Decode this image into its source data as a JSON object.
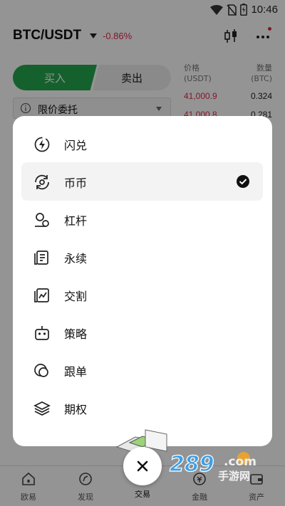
{
  "status_bar": {
    "time": "10:46"
  },
  "header": {
    "pair": "BTC/USDT",
    "change": "-0.86%"
  },
  "trade_tabs": {
    "buy": "买入",
    "sell": "卖出"
  },
  "order_type": {
    "label": "限价委托"
  },
  "order_book": {
    "price_header": "价格",
    "price_unit": "(USDT)",
    "qty_header": "数量",
    "qty_unit": "(BTC)",
    "rows": [
      {
        "price": "41,000.9",
        "qty": "0.324"
      },
      {
        "price": "41,000.8",
        "qty": "0.281"
      }
    ]
  },
  "menu": {
    "items": [
      {
        "label": "闪兑",
        "icon": "flash-swap-icon",
        "selected": false
      },
      {
        "label": "币币",
        "icon": "spot-icon",
        "selected": true
      },
      {
        "label": "杠杆",
        "icon": "margin-icon",
        "selected": false
      },
      {
        "label": "永续",
        "icon": "perpetual-icon",
        "selected": false
      },
      {
        "label": "交割",
        "icon": "futures-icon",
        "selected": false
      },
      {
        "label": "策略",
        "icon": "bot-icon",
        "selected": false
      },
      {
        "label": "跟单",
        "icon": "copy-trade-icon",
        "selected": false
      },
      {
        "label": "期权",
        "icon": "options-icon",
        "selected": false
      }
    ]
  },
  "bottom_nav": [
    {
      "label": "欧易",
      "icon": "home-icon"
    },
    {
      "label": "发现",
      "icon": "discover-icon"
    },
    {
      "label": "交易",
      "icon": "trade-icon"
    },
    {
      "label": "金融",
      "icon": "finance-icon"
    },
    {
      "label": "资产",
      "icon": "assets-icon"
    }
  ],
  "watermark": {
    "number": "289",
    "domain": ".com",
    "site": "手游网"
  },
  "colors": {
    "buy": "#25a750",
    "sell_red": "#e0294a",
    "overlay": "rgba(0,0,0,0.42)"
  }
}
